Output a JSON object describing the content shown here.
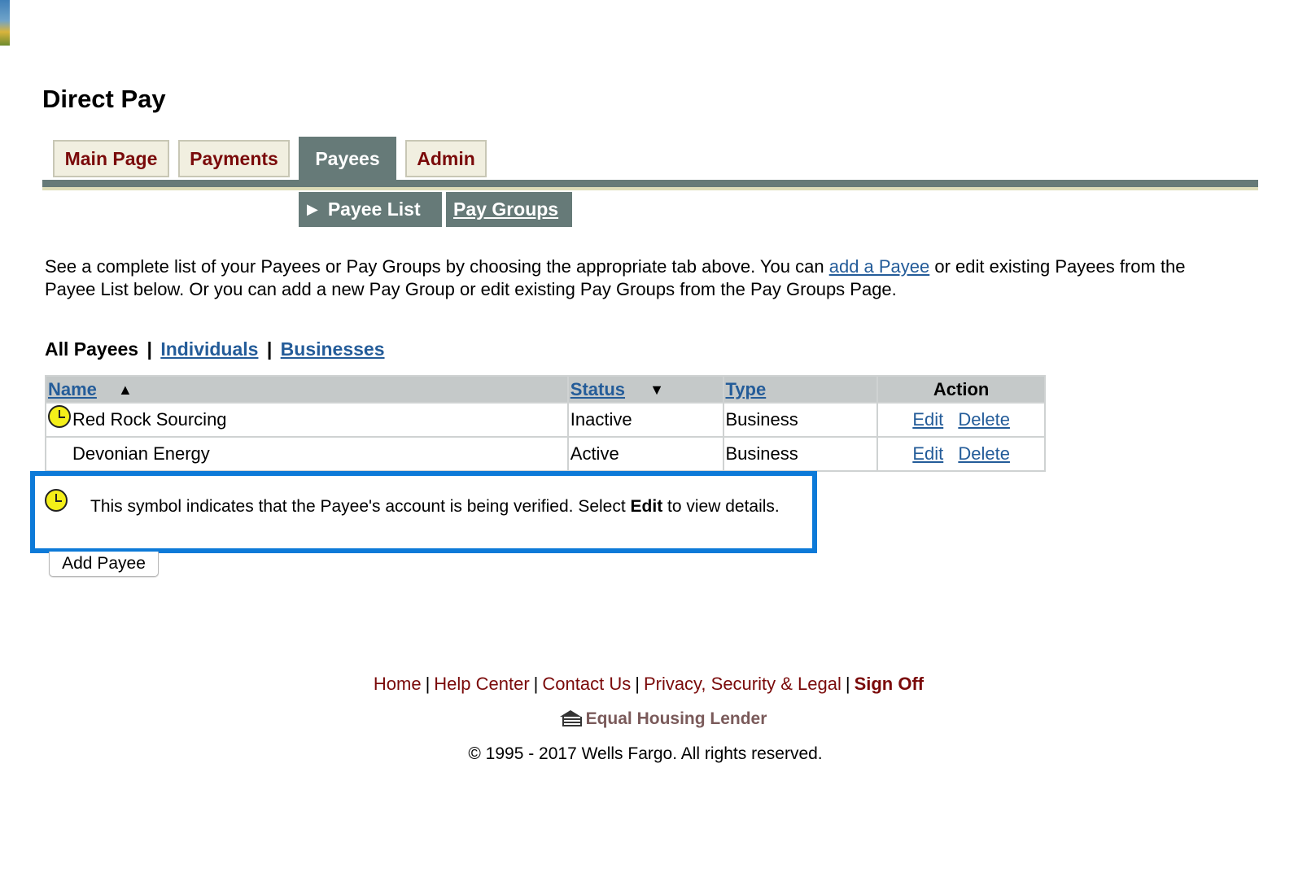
{
  "app": {
    "title": "Direct Pay"
  },
  "tabs": [
    {
      "label": "Main Page",
      "active": false
    },
    {
      "label": "Payments",
      "active": false
    },
    {
      "label": "Payees",
      "active": true
    },
    {
      "label": "Admin",
      "active": false
    }
  ],
  "subtabs": [
    {
      "label": "Payee List",
      "active": true
    },
    {
      "label": "Pay Groups",
      "active": false
    }
  ],
  "intro": {
    "part1": "See a complete list of your Payees or Pay Groups by choosing the appropriate tab above. You can ",
    "link": "add a Payee",
    "part2": " or edit existing Payees from the Payee List below. Or you can add a new Pay Group or edit existing Pay Groups from the Pay Groups Page."
  },
  "filter": {
    "all": "All Payees",
    "separator": "|",
    "individuals": "Individuals",
    "businesses": "Businesses"
  },
  "table": {
    "columns": {
      "name": "Name",
      "status": "Status",
      "type": "Type",
      "action": "Action"
    },
    "rows": [
      {
        "name": "Red Rock Sourcing",
        "status": "Inactive",
        "type": "Business",
        "edit": "Edit",
        "delete": "Delete",
        "verifying": true
      },
      {
        "name": "Devonian Energy",
        "status": "Active",
        "type": "Business",
        "edit": "Edit",
        "delete": "Delete",
        "verifying": false
      }
    ]
  },
  "notice": {
    "part1": "This symbol indicates that the Payee's account is being verified. Select ",
    "bold": "Edit",
    "part2": " to view details."
  },
  "buttons": {
    "add_payee": "Add Payee"
  },
  "footer": {
    "links": [
      "Home",
      "Help Center",
      "Contact Us",
      "Privacy, Security & Legal"
    ],
    "signoff": "Sign Off",
    "separator": "|",
    "equal_housing": "Equal Housing Lender",
    "copyright": "© 1995 - 2017 Wells Fargo. All rights reserved."
  },
  "colors": {
    "tab_active": "#667a78",
    "tab_text": "#7a0a0a",
    "link": "#245c99",
    "notice_border": "#0d7ad8",
    "clock_fill": "#f4ef19"
  },
  "icons": {
    "verifying": "clock-icon",
    "sort_asc": "triangle-up-icon",
    "sort_desc": "triangle-down-icon",
    "subtab_marker": "play-arrow-icon",
    "equal_housing": "house-icon"
  }
}
